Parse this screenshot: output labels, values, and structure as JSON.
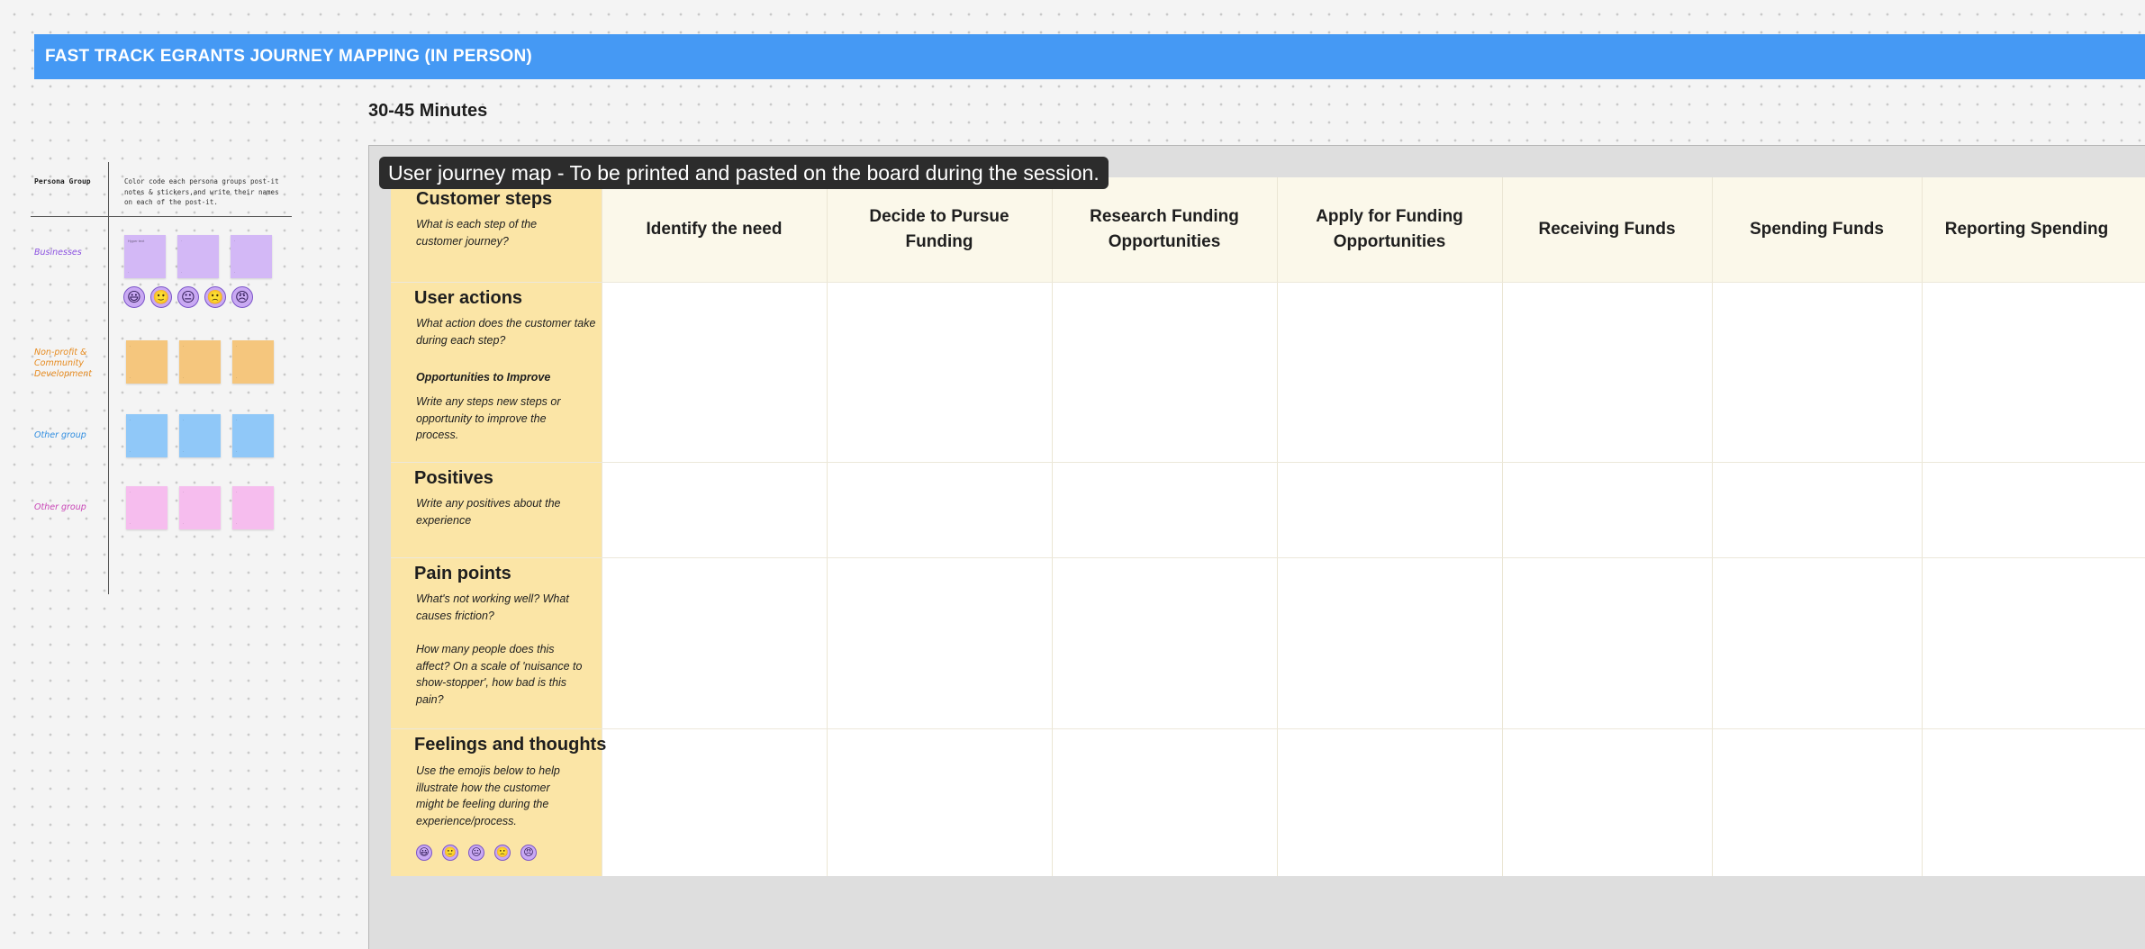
{
  "banner": {
    "title": "FAST TRACK EGRANTS JOURNEY MAPPING (IN PERSON)"
  },
  "duration": "30-45 Minutes",
  "legend": {
    "header": "Persona Group",
    "instructions": "Color code each persona groups post-it notes & stickers,and write their names on each of the post-it.",
    "groups": [
      {
        "label": "Businesses",
        "color": "#d3b8f6",
        "label_color": "#8a4fe0",
        "postit_title": "Hyper text"
      },
      {
        "label": "Non-profit & Community Development",
        "color": "#f5c67d",
        "label_color": "#e68a1e"
      },
      {
        "label": "Other group",
        "color": "#90c8f8",
        "label_color": "#2f8de0"
      },
      {
        "label": "Other group",
        "color": "#f6bdee",
        "label_color": "#c845b6"
      }
    ],
    "emojis": [
      "😃",
      "🙂",
      "😐",
      "🙁",
      "😠"
    ]
  },
  "board": {
    "caption": "User journey map - To be printed and pasted on the board during the session.",
    "rows": [
      {
        "title": "Customer steps",
        "desc": "What is each step of the customer journey?"
      },
      {
        "title": "User actions",
        "desc": "What action does the customer take during each step?",
        "opp_title": "Opportunities to Improve",
        "opp_desc": "Write any steps new steps or opportunity to improve the process."
      },
      {
        "title": "Positives",
        "desc": "Write any positives about the experience"
      },
      {
        "title": "Pain points",
        "desc": "What's not working well? What causes friction?",
        "desc2": "How many people does this affect? On a scale of 'nuisance to show-stopper', how bad is this pain?"
      },
      {
        "title": "Feelings and thoughts",
        "desc": "Use the emojis below to help illustrate how the customer might be feeling during the experience/process."
      }
    ],
    "steps": [
      "Identify the need",
      "Decide to Pursue Funding",
      "Research Funding Opportunities",
      "Apply for Funding Opportunities",
      "Receiving Funds",
      "Spending Funds",
      "Reporting Spending"
    ]
  }
}
